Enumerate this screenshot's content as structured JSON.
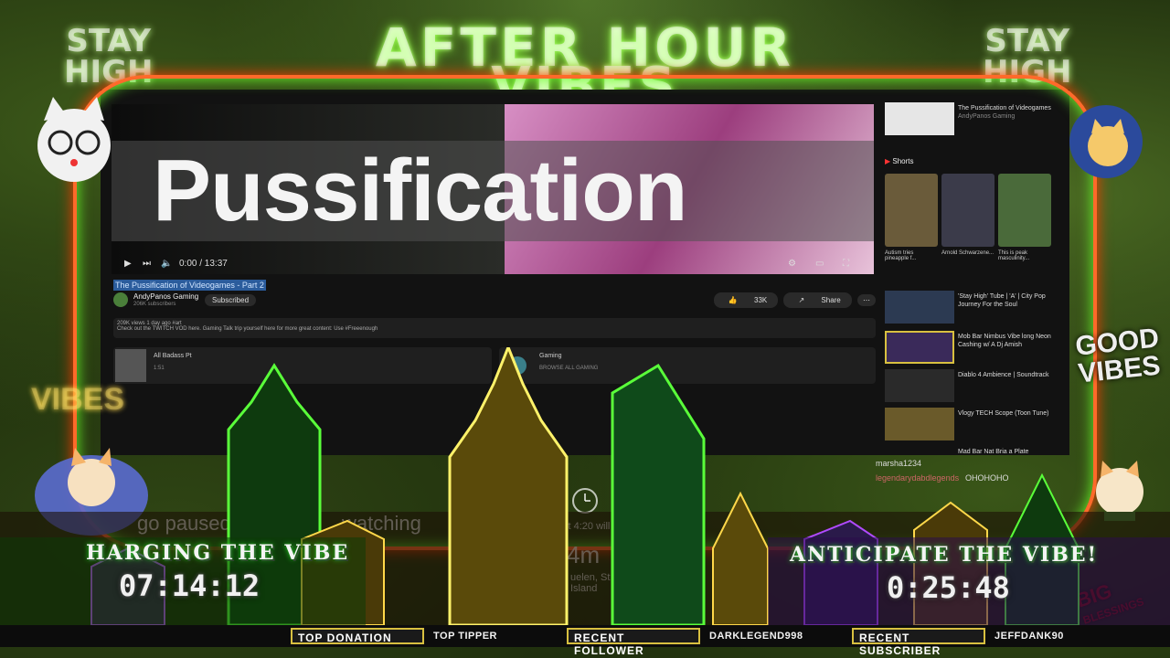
{
  "banner": {
    "line1": "AFTER HOUR",
    "line2": "VIBES",
    "badge_left_1": "STAY",
    "badge_left_2": "HIGH",
    "badge_right_1": "STAY",
    "badge_right_2": "HIGH"
  },
  "video": {
    "overlay_word": "Pussification",
    "title": "The Pussification of Videogames - Part 2",
    "time": "0:00 / 13:37",
    "channel_name": "AndyPanos Gaming",
    "channel_subs": "206K subscribers",
    "subscribe_label": "Subscribed",
    "like_count": "33K",
    "share_label": "Share",
    "desc_line1": "209K views 1 day ago  #art",
    "desc_line2": "Check out the TWITCH VOD here. Gaming Talk trip yourself here   for more great content: Use #Freeenough",
    "card1_title": "All Badass Pt",
    "card1_sub": "1:51",
    "card2_title": "Gaming",
    "card2_sub": "BROWSE ALL GAMING"
  },
  "sidebar": {
    "top_title": "The Pussification of Videogames",
    "top_sub": "AndyPanos Gaming",
    "shorts_label": "Shorts",
    "shorts": [
      {
        "caption": "Autism tries pineapple f..."
      },
      {
        "caption": "Arnold Schwarzene..."
      },
      {
        "caption": "This is peak masculinity..."
      }
    ],
    "rec1": "'Stay High' Tube | 'A' | City Pop Journey For the Soul",
    "rec2": "Mob Bar Nimbus Vibe long Neon Cashing w/ A Dj Amish",
    "rec3": "Diablo 4 Ambience | Soundtrack",
    "rec4": "Vlogy TECH Scope (Toon Tune)",
    "rec5": "Mad Bar Nat Bria a Plate"
  },
  "chat": {
    "user1": "marsha1234",
    "user2": "legendarydabdlegends",
    "msg2": "OHOHOHO"
  },
  "alerts": {
    "paused": "go paused",
    "watching": "watching",
    "weather_line": "xt 4:20 will be in",
    "weather_val": "4m",
    "weather_place": "uelen, St Paul Island,",
    "weather_place2": "Island",
    "good": "GOOD",
    "vibes": "VIBES",
    "vibes_left": "VIBES",
    "big": "BIG",
    "blessings": "BLESSINGS"
  },
  "timers": {
    "left_label": "HARGING THE VIBE",
    "left_value": "07:14:12",
    "right_label": "ANTICIPATE THE VIBE!",
    "right_value": "0:25:48"
  },
  "ticker": {
    "top_donation_label": "TOP DONATION",
    "top_tipper_label": "TOP TIPPER",
    "recent_follower_label": "RECENT FOLLOWER",
    "recent_follower_value": "DARKLEGEND998",
    "recent_subscriber_label": "RECENT SUBSCRIBER",
    "recent_subscriber_value": "JEFFDANK90"
  },
  "colors": {
    "frame": "#ff6a2a",
    "neon_green": "#6aff2a",
    "ticker_border": "#d8c040"
  }
}
